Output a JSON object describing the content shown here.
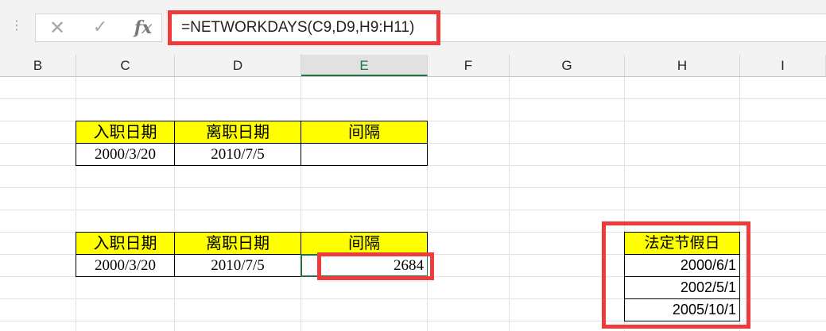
{
  "formula_bar": {
    "grip_icon": "⋮",
    "cancel_icon": "✕",
    "enter_icon": "✓",
    "fx_label": "fx",
    "formula": "=NETWORKDAYS(C9,D9,H9:H11)"
  },
  "columns": [
    "B",
    "C",
    "D",
    "E",
    "F",
    "G",
    "H",
    "I"
  ],
  "active_column": "E",
  "table1": {
    "headers": [
      "入职日期",
      "离职日期",
      "间隔"
    ],
    "row": [
      "2000/3/20",
      "2010/7/5",
      ""
    ]
  },
  "table2": {
    "headers": [
      "入职日期",
      "离职日期",
      "间隔"
    ],
    "row": [
      "2000/3/20",
      "2010/7/5"
    ],
    "result": "2684"
  },
  "holidays": {
    "header": "法定节假日",
    "dates": [
      "2000/6/1",
      "2002/5/1",
      "2005/10/1"
    ]
  },
  "colors": {
    "header_fill": "#ffff00",
    "highlight": "#ee3b3b",
    "selection": "#217346"
  }
}
